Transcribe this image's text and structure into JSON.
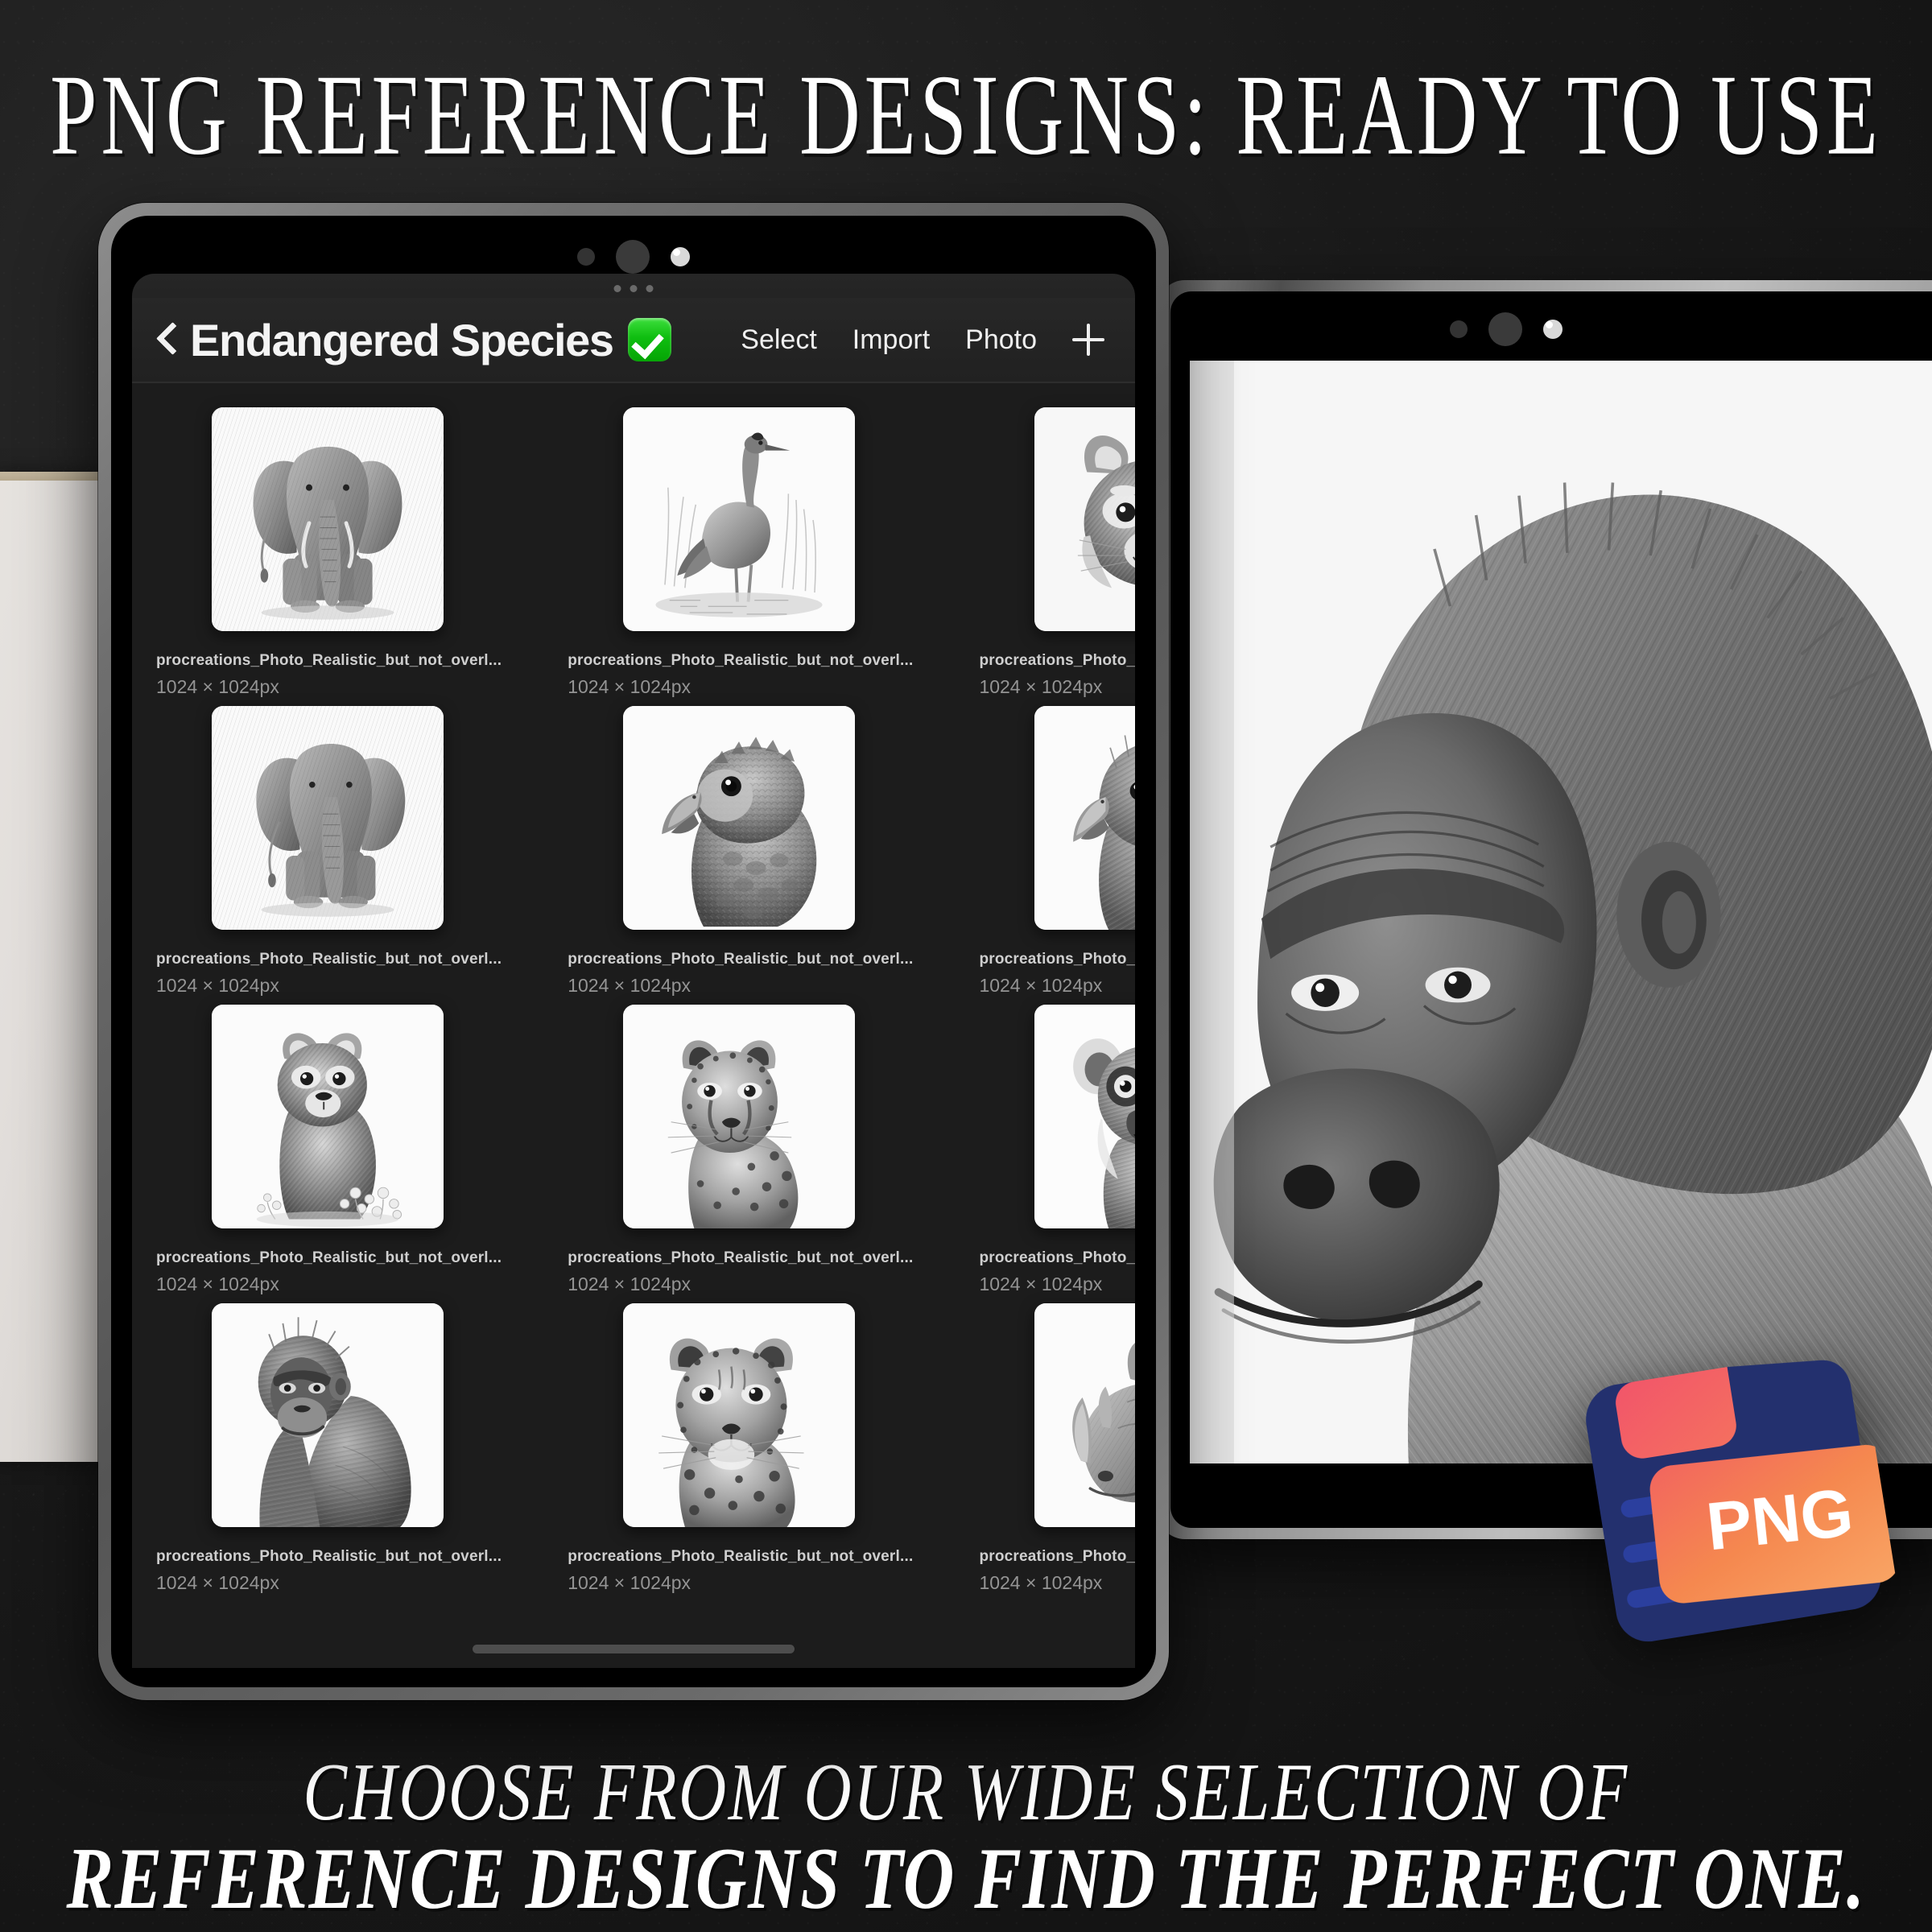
{
  "headline": "PNG REFERENCE DESIGNS: READY TO USE",
  "footer": {
    "line1": "CHOOSE FROM OUR WIDE SELECTION OF",
    "line2": "REFERENCE DESIGNS TO FIND THE PERFECT ONE."
  },
  "colors": {
    "background": "#191919",
    "app_surface": "#1c1c1c",
    "header_surface": "#272727",
    "accent_green": "#0fbe10",
    "badge_navy": "#23306e",
    "badge_orange": "#f5884f",
    "badge_red": "#f2556a",
    "text_primary": "#f4f4f4",
    "text_secondary": "#cfcfcf",
    "text_muted": "#949494"
  },
  "app": {
    "back_label": "Back",
    "title": "Endangered Species",
    "title_badge_icon": "green-check-badge",
    "actions": [
      {
        "label": "Select",
        "name": "select"
      },
      {
        "label": "Import",
        "name": "import"
      },
      {
        "label": "Photo",
        "name": "photo"
      }
    ],
    "add_icon": "plus-icon",
    "gallery": {
      "items": [
        {
          "name": "procreations_Photo_Realistic_but_not_overl...",
          "size": "1024 × 1024px",
          "subject": "elephant-front",
          "art": "elephant"
        },
        {
          "name": "procreations_Photo_Realistic_but_not_overl...",
          "size": "1024 × 1024px",
          "subject": "crane-bird",
          "art": "crane"
        },
        {
          "name": "procreations_Photo_Realistic_but_not_overl...",
          "size": "1024 × 1024px",
          "subject": "red-panda-face",
          "art": "redpanda"
        },
        {
          "name": "procreations_Photo_Realistic_but_not_overl...",
          "size": "1024 × 1024px",
          "subject": "elephant-walking",
          "art": "elephant"
        },
        {
          "name": "procreations_Photo_Realistic_but_not_overl...",
          "size": "1024 × 1024px",
          "subject": "kea-parrot",
          "art": "parrot"
        },
        {
          "name": "procreations_Photo_Realistic_but_not_overl...",
          "size": "1024 × 1024px",
          "subject": "kakapo-parrot",
          "art": "parrot"
        },
        {
          "name": "procreations_Photo_Realistic_but_not_overl...",
          "size": "1024 × 1024px",
          "subject": "red-panda-body",
          "art": "redpanda"
        },
        {
          "name": "procreations_Photo_Realistic_but_not_overl...",
          "size": "1024 × 1024px",
          "subject": "cheetah-portrait",
          "art": "bigcat"
        },
        {
          "name": "procreations_Photo_Realistic_but_not_overl...",
          "size": "1024 × 1024px",
          "subject": "lemur-face",
          "art": "lemur"
        },
        {
          "name": "procreations_Photo_Realistic_but_not_overl...",
          "size": "1024 × 1024px",
          "subject": "chimpanzee",
          "art": "ape"
        },
        {
          "name": "procreations_Photo_Realistic_but_not_overl...",
          "size": "1024 × 1024px",
          "subject": "leopard-portrait",
          "art": "bigcat"
        },
        {
          "name": "procreations_Photo_Realistic_but_not_overl...",
          "size": "1024 × 1024px",
          "subject": "rhinoceros",
          "art": "rhino"
        }
      ]
    }
  },
  "canvas": {
    "artwork_subject": "gorilla-portrait-pencil-sketch"
  },
  "png_badge": {
    "label": "PNG",
    "icon": "png-file-icon"
  }
}
